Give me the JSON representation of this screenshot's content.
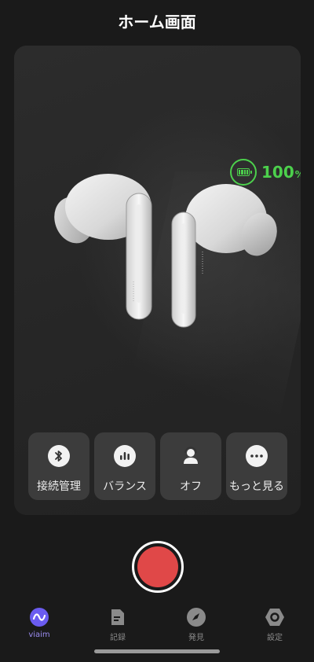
{
  "header": {
    "title": "ホーム画面"
  },
  "battery": {
    "value": "100",
    "unit": "%",
    "level": 1.0,
    "color": "#4cd04c"
  },
  "device": {
    "image": "earbuds-illustration"
  },
  "actions": [
    {
      "label": "接続管理",
      "icon": "bluetooth-icon"
    },
    {
      "label": "バランス",
      "icon": "equalizer-icon"
    },
    {
      "label": "オフ",
      "icon": "anc-person-icon"
    },
    {
      "label": "もっと見る",
      "icon": "more-icon"
    }
  ],
  "record": {
    "icon": "record-icon",
    "color": "#e04848"
  },
  "tabs": [
    {
      "label": "viaim",
      "icon": "viaim-logo-icon",
      "active": true
    },
    {
      "label": "記録",
      "icon": "document-icon",
      "active": false
    },
    {
      "label": "発見",
      "icon": "compass-icon",
      "active": false
    },
    {
      "label": "設定",
      "icon": "settings-hex-icon",
      "active": false
    }
  ],
  "colors": {
    "accent": "#6b5cf0",
    "background": "#1a1a1a",
    "card": "#2a2a2a"
  }
}
